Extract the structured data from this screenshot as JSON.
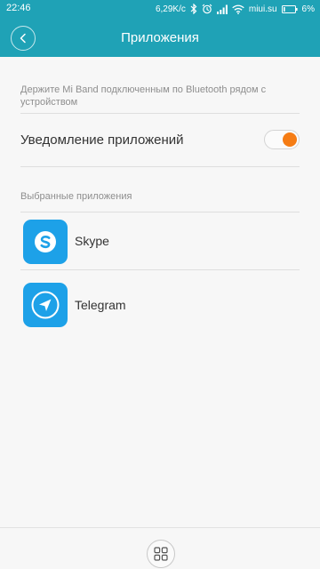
{
  "status_bar": {
    "time": "22:46",
    "speed": "6,29K/c",
    "carrier": "miui.su",
    "battery": "6%"
  },
  "app_bar": {
    "title": "Приложения"
  },
  "hint": "Держите Mi Band подключенным по Bluetooth рядом с устройством",
  "notifications": {
    "label": "Уведомление приложений",
    "enabled": true,
    "accent": "#f57c14"
  },
  "selected_apps": {
    "title": "Выбранные приложения",
    "items": [
      {
        "name": "Skype",
        "icon": "skype-icon"
      },
      {
        "name": "Telegram",
        "icon": "telegram-icon"
      }
    ]
  },
  "colors": {
    "header": "#1fa2b6",
    "app_icon": "#1da1e8"
  }
}
